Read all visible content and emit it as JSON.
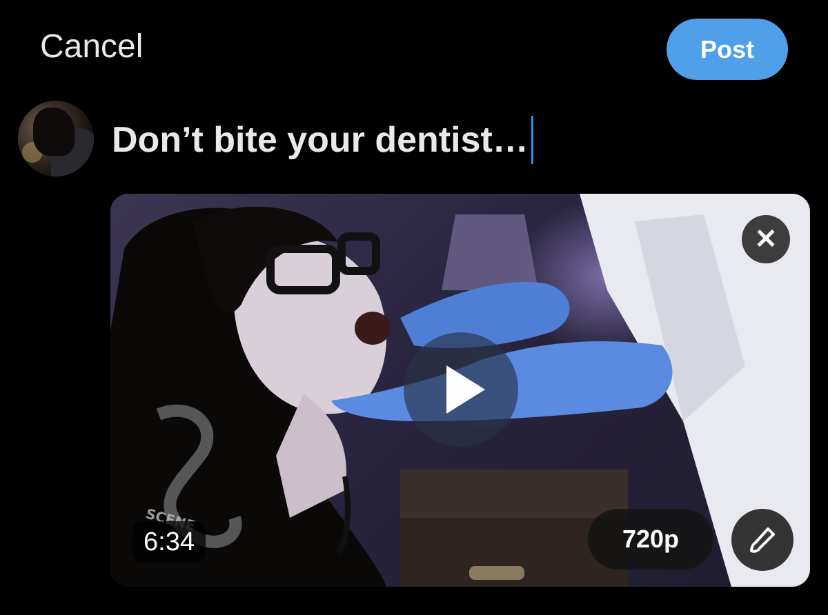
{
  "header": {
    "cancel_label": "Cancel",
    "post_label": "Post"
  },
  "composer": {
    "text": "Don’t bite your dentist…"
  },
  "media": {
    "duration": "6:34",
    "quality": "720p",
    "close_icon": "close-icon",
    "play_icon": "play-icon",
    "edit_icon": "paintbrush-icon",
    "watermark_text": "SCENE"
  },
  "colors": {
    "accent": "#4fa0e9",
    "cursor": "#1d9bf0",
    "background": "#000000",
    "text": "#e7e9ea"
  }
}
